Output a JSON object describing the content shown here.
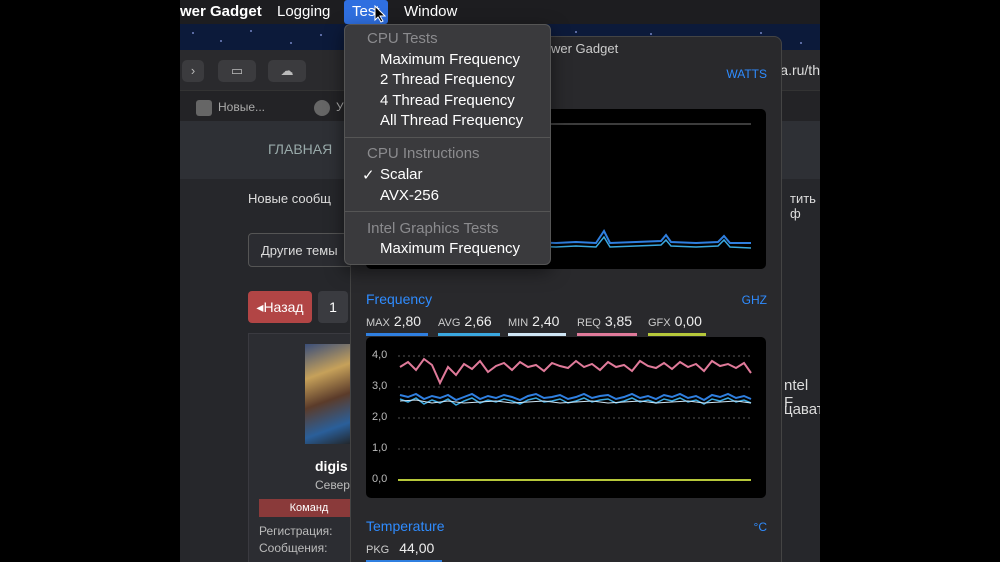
{
  "menubar": {
    "app_name": "wer Gadget",
    "items": [
      "Logging",
      "Test",
      "Window"
    ]
  },
  "test_menu": {
    "cpu_tests_header": "CPU Tests",
    "cpu_tests": [
      "Maximum Frequency",
      "2 Thread Frequency",
      "4 Thread Frequency",
      "All Thread Frequency"
    ],
    "cpu_instructions_header": "CPU Instructions",
    "check_mark": "✓",
    "instructions": [
      "Scalar",
      "AVX-256"
    ],
    "intel_graphics_header": "Intel Graphics Tests",
    "graphics_tests": [
      "Maximum Frequency"
    ]
  },
  "browser": {
    "url_fragment": "a.ru/th",
    "tabs": [
      "Новые...",
      "У"
    ]
  },
  "forum": {
    "nav_main": "ГЛАВНАЯ",
    "new_messages": "Новые сообщ",
    "right_text_1": "тить ф",
    "other_topics": "Другие темы",
    "back_button": "◂Назад",
    "page_1": "1",
    "username": "digis",
    "location": "Север",
    "role": "Команд",
    "registration_label": "Регистрация:",
    "messages_label": "Сообщения:",
    "side_text_1": "ntel F",
    "side_text_2": "цавати"
  },
  "power_gadget": {
    "window_title": "wer Gadget",
    "power_unit": "WATTS",
    "frequency_title": "Frequency",
    "frequency_unit": "GHZ",
    "metrics": [
      {
        "label": "MAX",
        "value": "2,80",
        "color": "#2f7fe0"
      },
      {
        "label": "AVG",
        "value": "2,66",
        "color": "#3aa8e0"
      },
      {
        "label": "MIN",
        "value": "2,40",
        "color": "#cfe6f5"
      },
      {
        "label": "REQ",
        "value": "3,85",
        "color": "#e07a9a"
      },
      {
        "label": "GFX",
        "value": "0,00",
        "color": "#b6c83a"
      }
    ],
    "y_ticks": [
      "4,0",
      "3,0",
      "2,0",
      "1,0",
      "0,0"
    ],
    "temperature_title": "Temperature",
    "temperature_unit": "°C",
    "pkg_label": "PKG",
    "pkg_value": "44,00"
  }
}
